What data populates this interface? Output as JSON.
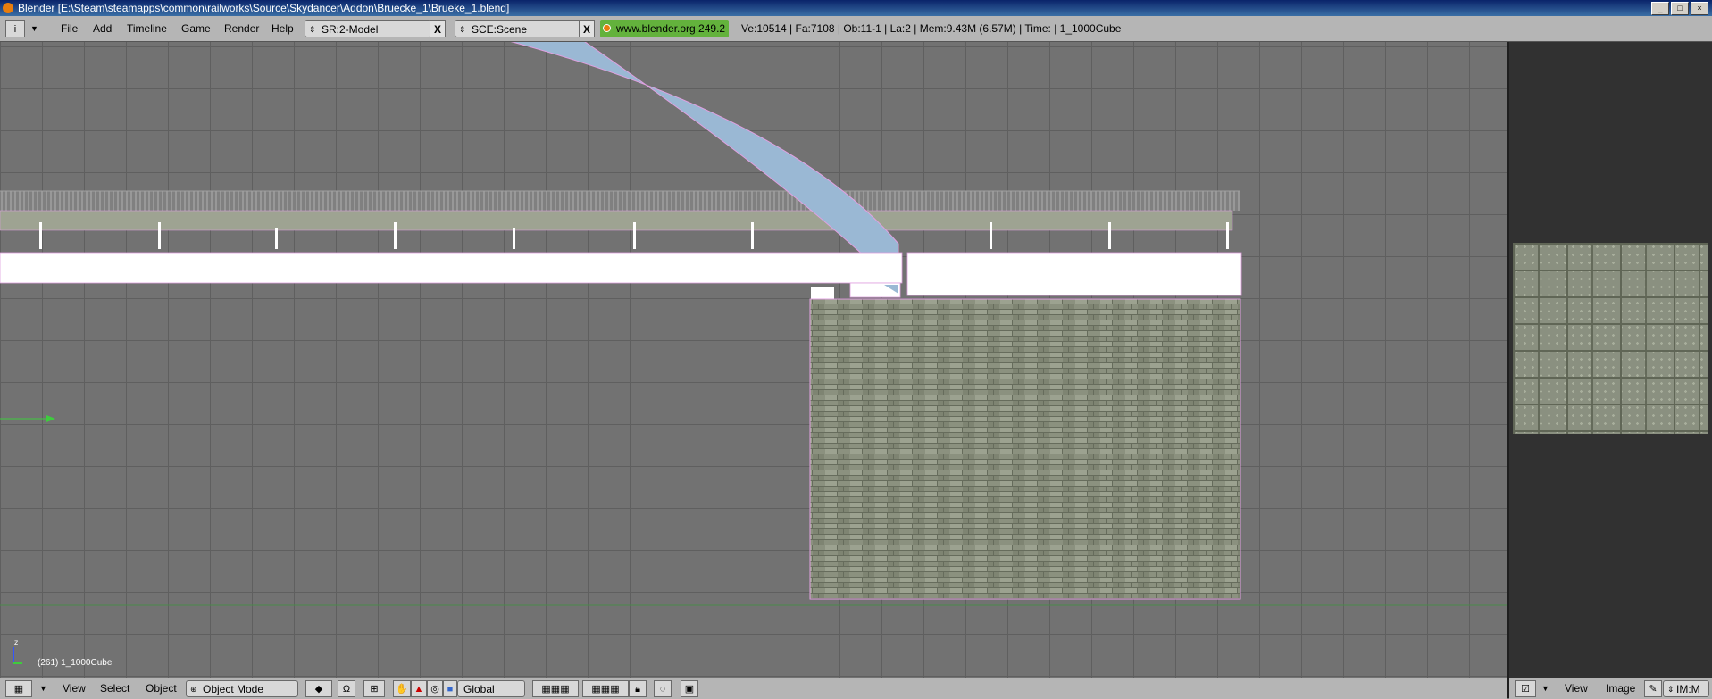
{
  "window": {
    "title": "Blender [E:\\Steam\\steamapps\\common\\railworks\\Source\\Skydancer\\Addon\\Bruecke_1\\Brueke_1.blend]",
    "buttons": [
      "_",
      "□",
      "×"
    ]
  },
  "header": {
    "menus": [
      "File",
      "Add",
      "Timeline",
      "Game",
      "Render",
      "Help"
    ],
    "screen": "SR:2-Model",
    "scene": "SCE:Scene",
    "close_label": "X",
    "site": "www.blender.org 249.2",
    "stats": "Ve:10514 | Fa:7108 | Ob:11-1 | La:2  | Mem:9.43M (6.57M) | Time: | 1_1000Cube"
  },
  "viewport": {
    "object_info": "(261) 1_1000Cube",
    "axis_label": "z"
  },
  "bottom_bar": {
    "menus": [
      "View",
      "Select",
      "Object"
    ],
    "mode": "Object Mode",
    "orientation": "Global"
  },
  "side_bar": {
    "menus": [
      "View",
      "Image"
    ],
    "image_name": "IM:M"
  },
  "colors": {
    "selection_outline": "#e0a0e0",
    "arch": "#9ab8d4",
    "wall": "#8a907e",
    "site_green": "#63b23c"
  }
}
